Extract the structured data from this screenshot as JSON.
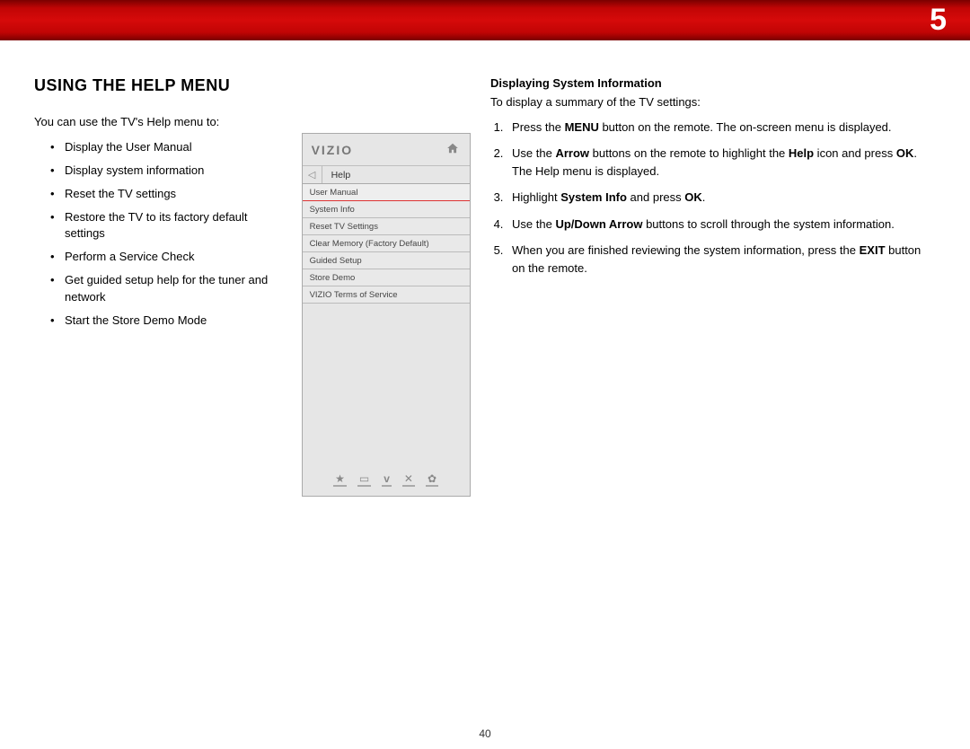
{
  "chapter_number": "5",
  "page_number": "40",
  "left": {
    "heading": "USING THE HELP MENU",
    "intro": "You can use the TV's Help menu to:",
    "bullets": [
      "Display the User Manual",
      "Display system information",
      "Reset the TV settings",
      "Restore the TV to its factory default settings",
      "Perform a Service Check",
      "Get guided setup help for the tuner and network",
      "Start the Store Demo Mode"
    ]
  },
  "tv_menu": {
    "brand": "VIZIO",
    "home_icon": "home-icon",
    "back_icon": "back-icon",
    "title": "Help",
    "selected_index": 0,
    "items": [
      "User Manual",
      "System Info",
      "Reset TV Settings",
      "Clear Memory (Factory Default)",
      "Guided Setup",
      "Store Demo",
      "VIZIO Terms of Service"
    ],
    "bottom_icons": [
      "star-icon",
      "screen-icon",
      "v-icon",
      "close-icon",
      "gear-icon"
    ]
  },
  "right": {
    "subheading": "Displaying System Information",
    "intro": "To display a summary of the TV settings:",
    "steps_html": [
      "Press the <b>MENU</b> button on the remote. The on-screen menu is displayed.",
      "Use the <b>Arrow</b> buttons on the remote to highlight the <b>Help</b> icon and press <b>OK</b>. The Help menu is displayed.",
      "Highlight <b>System Info</b> and press <b>OK</b>.",
      "Use the <b>Up/Down Arrow</b> buttons to scroll through the system information.",
      "When you are finished reviewing the system information, press the <b>EXIT</b> button on the remote."
    ]
  }
}
